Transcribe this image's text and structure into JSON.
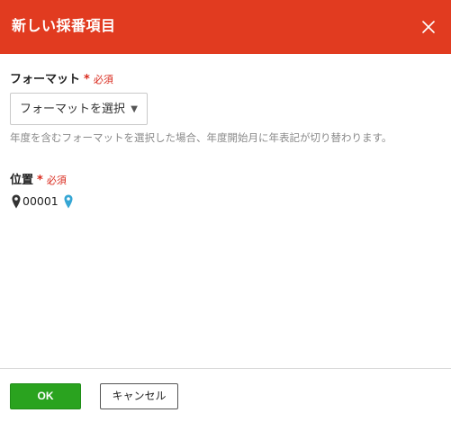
{
  "dialog": {
    "title": "新しい採番項目",
    "header_color": "#e13b20"
  },
  "format_field": {
    "label": "フォーマット",
    "required_star": "*",
    "required_text": "必須",
    "select_value": "フォーマットを選択",
    "select_caret": "▼",
    "hint": "年度を含むフォーマットを選択した場合、年度開始月に年表記が切り替わります。"
  },
  "position_field": {
    "label": "位置",
    "required_star": "*",
    "required_text": "必須",
    "value": "00001",
    "value_icon": "map-pin-icon",
    "insert_icon": "map-pin-icon",
    "insert_icon_color": "#35a6d4"
  },
  "footer": {
    "ok_label": "OK",
    "cancel_label": "キャンセル",
    "ok_color": "#2aa31f"
  }
}
